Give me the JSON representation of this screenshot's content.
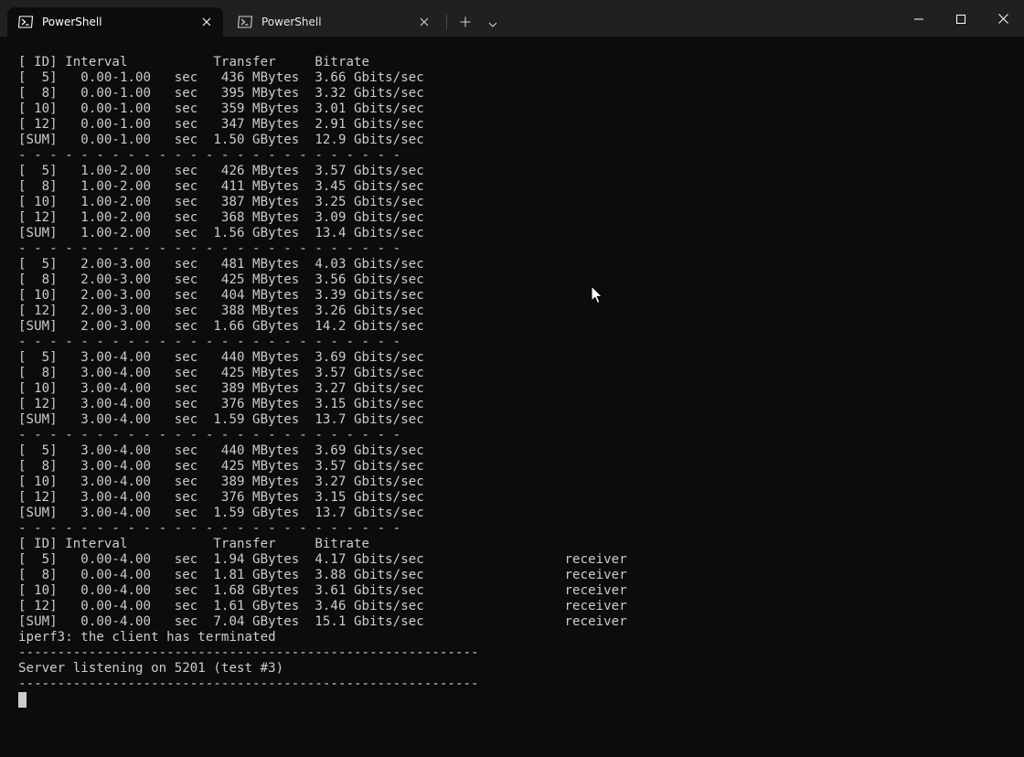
{
  "titlebar": {
    "tabs": [
      {
        "label": "PowerShell",
        "icon": "powershell-icon",
        "active": true,
        "close_icon": "close-icon"
      },
      {
        "label": "PowerShell",
        "icon": "powershell-icon",
        "active": false,
        "close_icon": "close-icon"
      }
    ],
    "new_tab_icon": "plus-icon",
    "dropdown_icon": "chevron-down-icon",
    "window_controls": [
      "minimize-icon",
      "maximize-icon",
      "close-icon"
    ]
  },
  "terminal": {
    "lines": [
      "[ ID] Interval           Transfer     Bitrate",
      "[  5]   0.00-1.00   sec   436 MBytes  3.66 Gbits/sec",
      "[  8]   0.00-1.00   sec   395 MBytes  3.32 Gbits/sec",
      "[ 10]   0.00-1.00   sec   359 MBytes  3.01 Gbits/sec",
      "[ 12]   0.00-1.00   sec   347 MBytes  2.91 Gbits/sec",
      "[SUM]   0.00-1.00   sec  1.50 GBytes  12.9 Gbits/sec",
      "- - - - - - - - - - - - - - - - - - - - - - - - -",
      "[  5]   1.00-2.00   sec   426 MBytes  3.57 Gbits/sec",
      "[  8]   1.00-2.00   sec   411 MBytes  3.45 Gbits/sec",
      "[ 10]   1.00-2.00   sec   387 MBytes  3.25 Gbits/sec",
      "[ 12]   1.00-2.00   sec   368 MBytes  3.09 Gbits/sec",
      "[SUM]   1.00-2.00   sec  1.56 GBytes  13.4 Gbits/sec",
      "- - - - - - - - - - - - - - - - - - - - - - - - -",
      "[  5]   2.00-3.00   sec   481 MBytes  4.03 Gbits/sec",
      "[  8]   2.00-3.00   sec   425 MBytes  3.56 Gbits/sec",
      "[ 10]   2.00-3.00   sec   404 MBytes  3.39 Gbits/sec",
      "[ 12]   2.00-3.00   sec   388 MBytes  3.26 Gbits/sec",
      "[SUM]   2.00-3.00   sec  1.66 GBytes  14.2 Gbits/sec",
      "- - - - - - - - - - - - - - - - - - - - - - - - -",
      "[  5]   3.00-4.00   sec   440 MBytes  3.69 Gbits/sec",
      "[  8]   3.00-4.00   sec   425 MBytes  3.57 Gbits/sec",
      "[ 10]   3.00-4.00   sec   389 MBytes  3.27 Gbits/sec",
      "[ 12]   3.00-4.00   sec   376 MBytes  3.15 Gbits/sec",
      "[SUM]   3.00-4.00   sec  1.59 GBytes  13.7 Gbits/sec",
      "- - - - - - - - - - - - - - - - - - - - - - - - -",
      "[  5]   3.00-4.00   sec   440 MBytes  3.69 Gbits/sec",
      "[  8]   3.00-4.00   sec   425 MBytes  3.57 Gbits/sec",
      "[ 10]   3.00-4.00   sec   389 MBytes  3.27 Gbits/sec",
      "[ 12]   3.00-4.00   sec   376 MBytes  3.15 Gbits/sec",
      "[SUM]   3.00-4.00   sec  1.59 GBytes  13.7 Gbits/sec",
      "- - - - - - - - - - - - - - - - - - - - - - - - -",
      "[ ID] Interval           Transfer     Bitrate",
      "[  5]   0.00-4.00   sec  1.94 GBytes  4.17 Gbits/sec                  receiver",
      "[  8]   0.00-4.00   sec  1.81 GBytes  3.88 Gbits/sec                  receiver",
      "[ 10]   0.00-4.00   sec  1.68 GBytes  3.61 Gbits/sec                  receiver",
      "[ 12]   0.00-4.00   sec  1.61 GBytes  3.46 Gbits/sec                  receiver",
      "[SUM]   0.00-4.00   sec  7.04 GBytes  15.1 Gbits/sec                  receiver",
      "iperf3: the client has terminated",
      "-----------------------------------------------------------",
      "Server listening on 5201 (test #3)",
      "-----------------------------------------------------------"
    ]
  },
  "colors": {
    "terminal_bg": "#0c0c0c",
    "titlebar_bg": "#202020",
    "text": "#cccccc"
  }
}
